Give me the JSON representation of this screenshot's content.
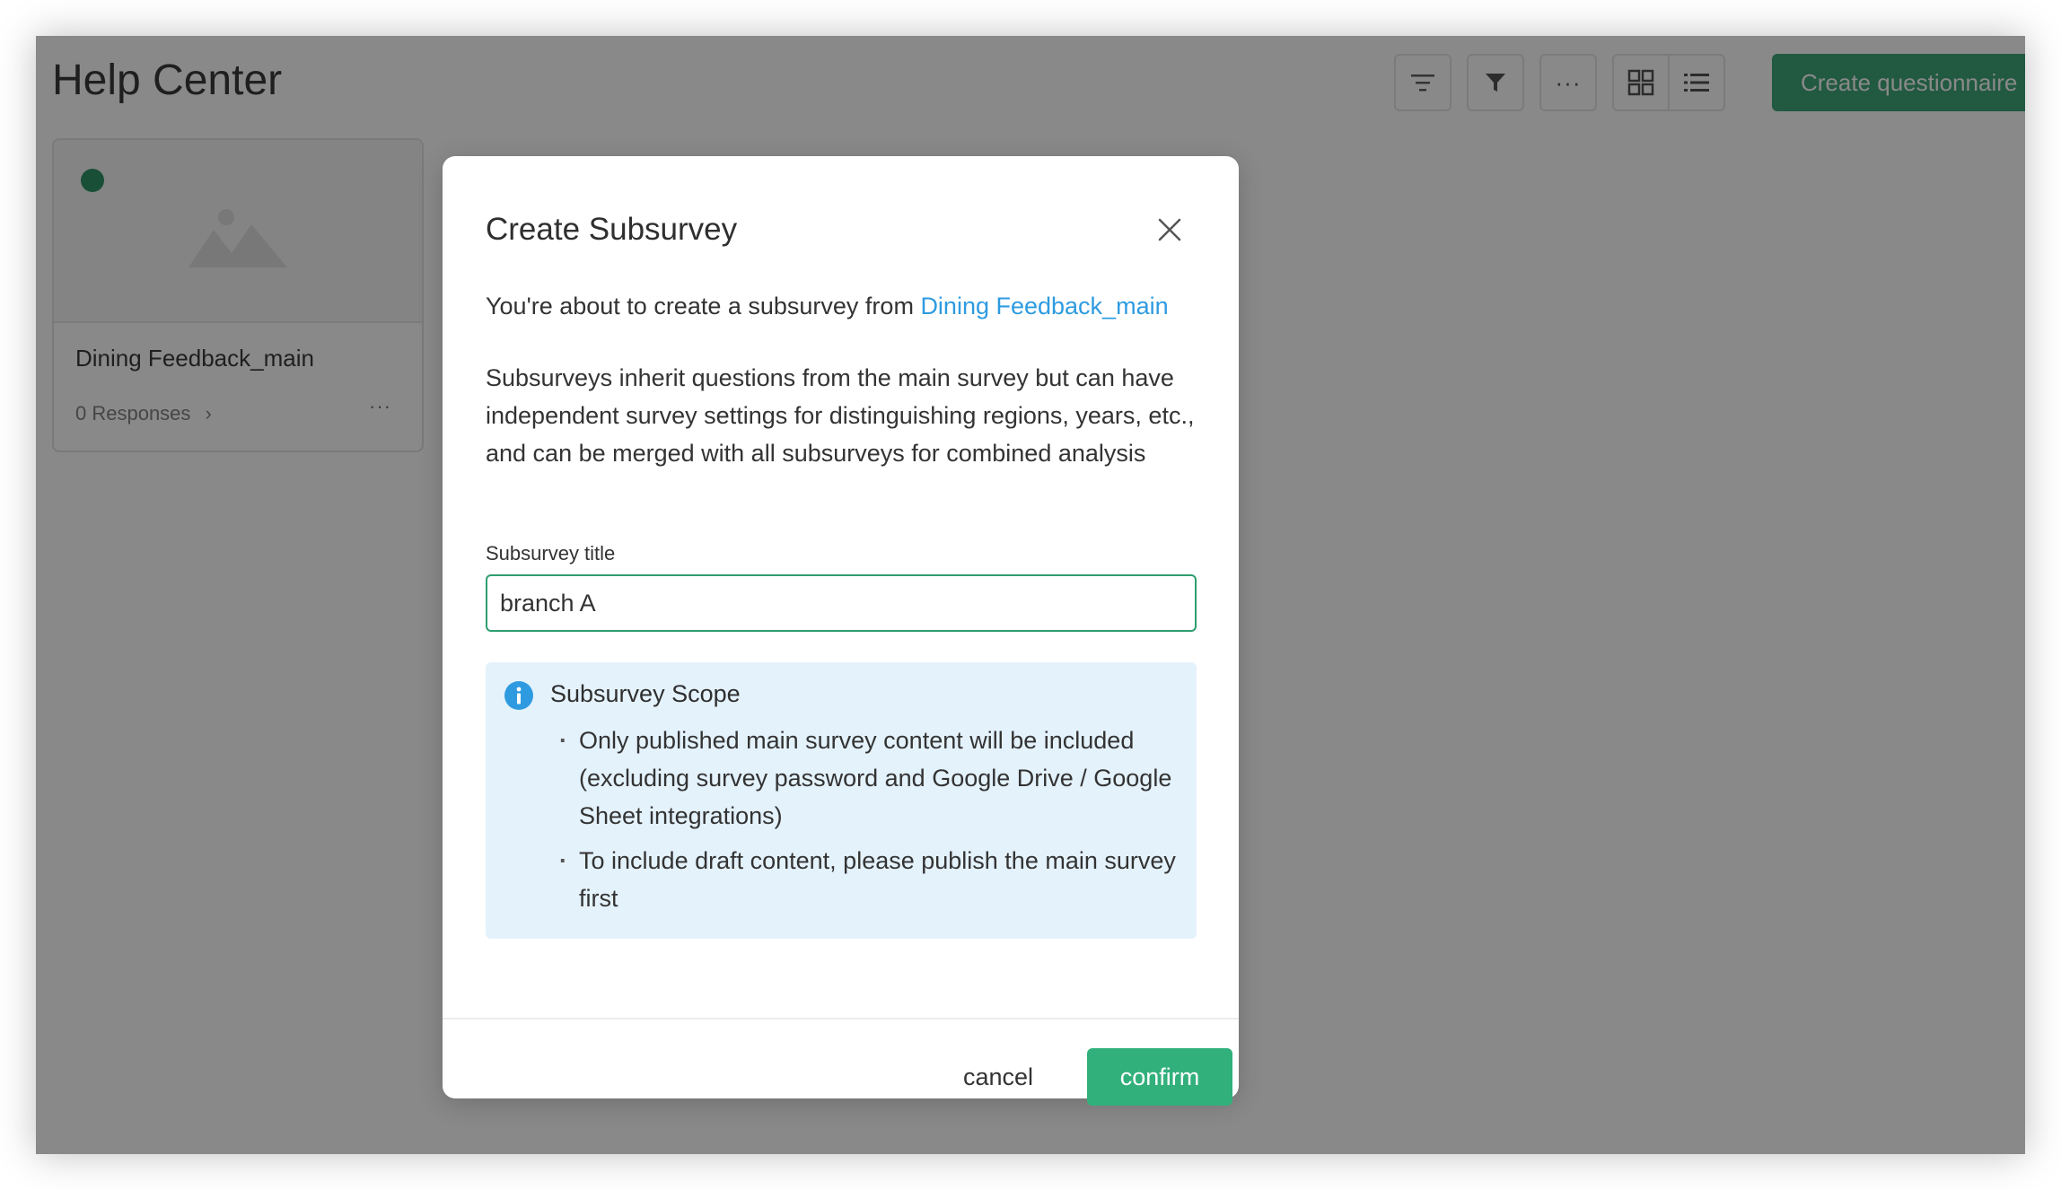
{
  "page": {
    "title": "Help Center",
    "create_button": "Create questionnaire",
    "create_button_icon": "plus-icon"
  },
  "toolbar": {
    "icons": [
      "sort-icon",
      "filter-icon",
      "more-icon",
      "grid-view-icon",
      "list-view-icon"
    ]
  },
  "card": {
    "name": "Dining Feedback_main",
    "responses": "0 Responses",
    "status_color": "#1f8a5b"
  },
  "modal": {
    "title": "Create Subsurvey",
    "intro_prefix": "You're about to create a subsurvey from ",
    "intro_link": "Dining Feedback_main",
    "description": "Subsurveys inherit questions from the main survey but can have independent survey settings for distinguishing regions, years, etc., and can be merged with all subsurveys for combined analysis",
    "field_label": "Subsurvey title",
    "field_value": "branch A",
    "scope": {
      "title": "Subsurvey Scope",
      "items": [
        "Only published main survey content will be included (excluding survey password and Google Drive / Google Sheet integrations)",
        "To include draft content, please publish the main survey first"
      ]
    },
    "cancel_label": "cancel",
    "confirm_label": "confirm"
  },
  "colors": {
    "accent": "#2e9e6e",
    "link": "#2e9be0",
    "info_bg": "#e4f2fc"
  }
}
